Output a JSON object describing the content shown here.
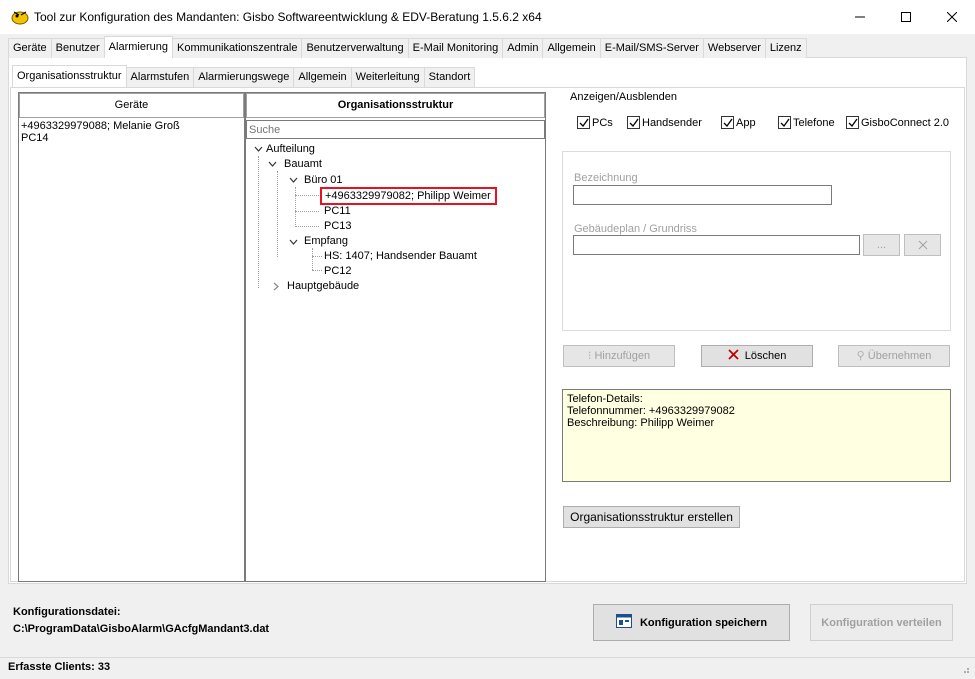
{
  "window": {
    "title": "Tool zur Konfiguration des Mandanten: Gisbo Softwareentwicklung & EDV-Beratung 1.5.6.2 x64",
    "minimize": "—",
    "maximize": "☐",
    "close": "✕"
  },
  "outer_tabs": [
    "Geräte",
    "Benutzer",
    "Alarmierung",
    "Kommunikationszentrale",
    "Benutzerverwaltung",
    "E-Mail Monitoring",
    "Admin",
    "Allgemein",
    "E-Mail/SMS-Server",
    "Webserver",
    "Lizenz"
  ],
  "outer_tab_active": "Alarmierung",
  "inner_tabs": [
    "Organisationsstruktur",
    "Alarmstufen",
    "Alarmierungswege",
    "Allgemein",
    "Weiterleitung",
    "Standort"
  ],
  "inner_tab_active": "Organisationsstruktur",
  "devices": {
    "header": "Geräte",
    "items": [
      "+4963329979088; Melanie Groß",
      "PC14"
    ]
  },
  "org": {
    "header": "Organisationsstruktur",
    "search_placeholder": "Suche",
    "tree": {
      "root": "Aufteilung",
      "bauamt": "Bauamt",
      "buero": "Büro 01",
      "selected": "+4963329979082; Philipp Weimer",
      "pc11": "PC11",
      "pc13": "PC13",
      "empfang": "Empfang",
      "hs": "HS: 1407; Handsender Bauamt",
      "pc12": "PC12",
      "haupt": "Hauptgebäude"
    }
  },
  "show_hide": {
    "title": "Anzeigen/Ausblenden",
    "options": [
      {
        "label": "PCs",
        "checked": true
      },
      {
        "label": "Handsender",
        "checked": true
      },
      {
        "label": "App",
        "checked": true
      },
      {
        "label": "Telefone",
        "checked": true
      },
      {
        "label": "GisboConnect 2.0",
        "checked": true
      }
    ]
  },
  "form": {
    "bezeichnung_label": "Bezeichnung",
    "bezeichnung_value": "",
    "plan_label": "Gebäudeplan / Grundriss",
    "plan_value": "",
    "browse_label": "...",
    "clear_label": "✕"
  },
  "actions": {
    "add": "Hinzufügen",
    "delete": "Löschen",
    "apply": "Übernehmen"
  },
  "details": {
    "line1": "Telefon-Details:",
    "line2": "Telefonnummer: +4963329979082",
    "line3": "Beschreibung: Philipp Weimer"
  },
  "create_button": "Organisationsstruktur erstellen",
  "footer": {
    "cfg_label": "Konfigurationsdatei:",
    "cfg_path": "C:\\ProgramData\\GisboAlarm\\GAcfgMandant3.dat",
    "save": "Konfiguration speichern",
    "distribute": "Konfiguration verteilen"
  },
  "status": "Erfasste Clients: 33",
  "colors": {
    "selection_border": "#e81123",
    "details_bg": "#ffffe1",
    "delete_icon": "#c00000"
  }
}
